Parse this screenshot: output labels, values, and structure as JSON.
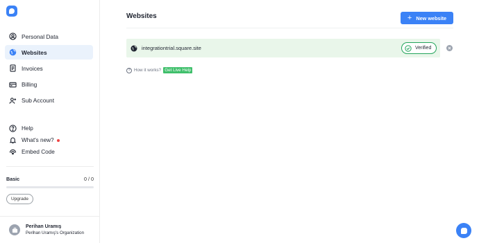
{
  "sidebar": {
    "items": [
      {
        "label": "Personal Data",
        "icon": "user-circle-icon"
      },
      {
        "label": "Websites",
        "icon": "globe-icon",
        "active": true
      },
      {
        "label": "Invoices",
        "icon": "document-icon"
      },
      {
        "label": "Billing",
        "icon": "credit-card-icon"
      },
      {
        "label": "Sub Account",
        "icon": "add-user-icon"
      }
    ],
    "secondary": [
      {
        "label": "Help",
        "icon": "help-circle-icon"
      },
      {
        "label": "What's new?",
        "icon": "bell-icon",
        "badge_color": "#ef4444"
      },
      {
        "label": "Embed Code",
        "icon": "embed-icon"
      }
    ],
    "plan": {
      "name": "Basic",
      "usage": "0 / 0",
      "upgrade_label": "Upgrade"
    },
    "user": {
      "name": "Perihan Uramış",
      "organization": "Perihan Uramış's Organization"
    }
  },
  "main": {
    "title": "Websites",
    "new_button_label": "New website",
    "websites": [
      {
        "url": "integrationtrial.square.site",
        "status": "Verified"
      }
    ],
    "how_it_works": "How it works?",
    "live_help_label": "Get Live Help"
  },
  "colors": {
    "accent": "#3b82f6",
    "verified": "#22a45a",
    "row_bg": "#e9f6ea",
    "live_help": "#3fbf6b"
  }
}
